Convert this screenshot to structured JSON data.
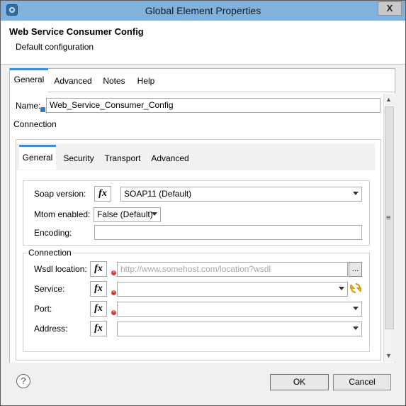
{
  "window": {
    "title": "Global Element Properties",
    "close_glyph": "X"
  },
  "header": {
    "title": "Web Service Consumer Config",
    "subtitle": "Default configuration"
  },
  "outer_tabs": [
    "General",
    "Advanced",
    "Notes",
    "Help"
  ],
  "name_field": {
    "label": "Name:",
    "value": "Web_Service_Consumer_Config"
  },
  "connection_label": "Connection",
  "inner_tabs": [
    "General",
    "Security",
    "Transport",
    "Advanced"
  ],
  "general": {
    "soap_version_label": "Soap version:",
    "soap_version_value": "SOAP11 (Default)",
    "mtom_label": "Mtom enabled:",
    "mtom_value": "False (Default)",
    "encoding_label": "Encoding:",
    "encoding_value": ""
  },
  "connection": {
    "group_label": "Connection",
    "wsdl_label": "Wsdl location:",
    "wsdl_placeholder": "http://www.somehost.com/location?wsdl",
    "browse_label": "...",
    "service_label": "Service:",
    "port_label": "Port:",
    "address_label": "Address:"
  },
  "fx_label": "fx",
  "footer": {
    "help_glyph": "?",
    "ok_label": "OK",
    "cancel_label": "Cancel"
  },
  "colors": {
    "titlebar": "#7fb2dd",
    "tab_accent": "#3b8fd6",
    "error": "#d53a3a"
  }
}
